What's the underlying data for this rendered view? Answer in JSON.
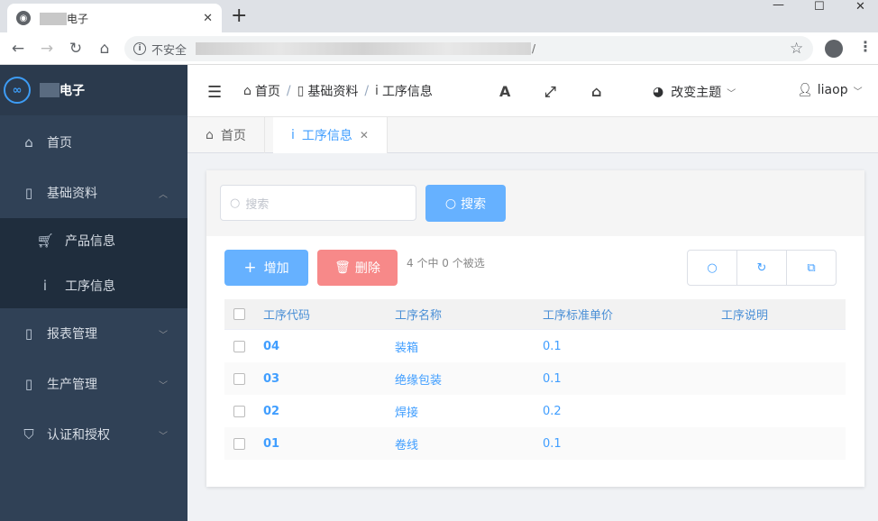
{
  "browser": {
    "tab_title": "电子",
    "tab_close": "✕",
    "new_tab": "+",
    "insecure_label": "不安全",
    "url_suffix": "/",
    "window": {
      "minimize": "—",
      "maximize": "☐",
      "close": "✕"
    }
  },
  "sidebar": {
    "brand": "电子",
    "brand_logo": "∞",
    "items": [
      {
        "label": "首页",
        "icon": "home-icon"
      },
      {
        "label": "基础资料",
        "icon": "document-icon",
        "expanded": true,
        "children": [
          {
            "label": "产品信息",
            "icon": "cart-icon"
          },
          {
            "label": "工序信息",
            "icon": "info-icon"
          }
        ]
      },
      {
        "label": "报表管理",
        "icon": "document-icon"
      },
      {
        "label": "生产管理",
        "icon": "document-icon"
      },
      {
        "label": "认证和授权",
        "icon": "shield-icon"
      }
    ]
  },
  "header": {
    "breadcrumb": [
      "首页",
      "基础资料",
      "工序信息"
    ],
    "theme_label": "改变主题",
    "user": "liaop"
  },
  "tags": [
    {
      "label": "首页",
      "active": false
    },
    {
      "label": "工序信息",
      "active": true
    }
  ],
  "toolbar": {
    "search_placeholder": "搜索",
    "search_button": "搜索",
    "add_button": "增加",
    "delete_button": "删除",
    "selection_info": "4 个中 0 个被选"
  },
  "table": {
    "columns": [
      "工序代码",
      "工序名称",
      "工序标准单价",
      "工序说明"
    ],
    "rows": [
      [
        "04",
        "装箱",
        "0.1",
        ""
      ],
      [
        "03",
        "绝缘包装",
        "0.1",
        ""
      ],
      [
        "02",
        "焊接",
        "0.2",
        ""
      ],
      [
        "01",
        "卷线",
        "0.1",
        ""
      ]
    ]
  },
  "colors": {
    "sidebar_bg": "#304156",
    "primary": "#409eff",
    "danger": "#f78989"
  }
}
